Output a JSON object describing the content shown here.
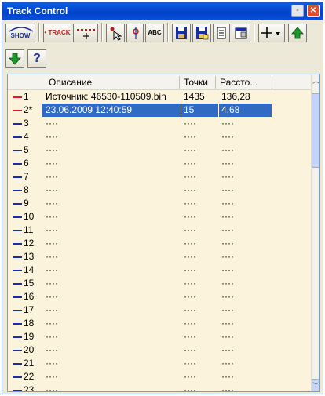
{
  "window": {
    "title": "Track Control"
  },
  "toolbar": {
    "show_label": "SHOW",
    "track_label": "• TRACK",
    "abc_label": "ABC"
  },
  "toolbar2": {
    "help_label": "?"
  },
  "list": {
    "columns": {
      "description": "Описание",
      "points": "Точки",
      "distance": "Рассто..."
    },
    "rows": [
      {
        "num": "1",
        "color": "#e0182a",
        "description": "Источник: 46530-110509.bin",
        "points": "1435",
        "distance": "136,28"
      },
      {
        "num": "2*",
        "color": "#e0182a",
        "description": "23.06.2009 12:40:59",
        "points": "15",
        "distance": "4,68",
        "selected": true
      },
      {
        "num": "3",
        "color": "#1a2ea0",
        "description": "····",
        "points": "····",
        "distance": "····"
      },
      {
        "num": "4",
        "color": "#1a2ea0",
        "description": "····",
        "points": "····",
        "distance": "····"
      },
      {
        "num": "5",
        "color": "#1a2ea0",
        "description": "····",
        "points": "····",
        "distance": "····"
      },
      {
        "num": "6",
        "color": "#1a2ea0",
        "description": "····",
        "points": "····",
        "distance": "····"
      },
      {
        "num": "7",
        "color": "#1a2ea0",
        "description": "····",
        "points": "····",
        "distance": "····"
      },
      {
        "num": "8",
        "color": "#1a2ea0",
        "description": "····",
        "points": "····",
        "distance": "····"
      },
      {
        "num": "9",
        "color": "#1a2ea0",
        "description": "····",
        "points": "····",
        "distance": "····"
      },
      {
        "num": "10",
        "color": "#1a2ea0",
        "description": "····",
        "points": "····",
        "distance": "····"
      },
      {
        "num": "11",
        "color": "#1a2ea0",
        "description": "····",
        "points": "····",
        "distance": "····"
      },
      {
        "num": "12",
        "color": "#1a2ea0",
        "description": "····",
        "points": "····",
        "distance": "····"
      },
      {
        "num": "13",
        "color": "#1a2ea0",
        "description": "····",
        "points": "····",
        "distance": "····"
      },
      {
        "num": "14",
        "color": "#1a2ea0",
        "description": "····",
        "points": "····",
        "distance": "····"
      },
      {
        "num": "15",
        "color": "#1a2ea0",
        "description": "····",
        "points": "····",
        "distance": "····"
      },
      {
        "num": "16",
        "color": "#1a2ea0",
        "description": "····",
        "points": "····",
        "distance": "····"
      },
      {
        "num": "17",
        "color": "#1a2ea0",
        "description": "····",
        "points": "····",
        "distance": "····"
      },
      {
        "num": "18",
        "color": "#1a2ea0",
        "description": "····",
        "points": "····",
        "distance": "····"
      },
      {
        "num": "19",
        "color": "#1a2ea0",
        "description": "····",
        "points": "····",
        "distance": "····"
      },
      {
        "num": "20",
        "color": "#1a2ea0",
        "description": "····",
        "points": "····",
        "distance": "····"
      },
      {
        "num": "21",
        "color": "#1a2ea0",
        "description": "····",
        "points": "····",
        "distance": "····"
      },
      {
        "num": "22",
        "color": "#1a2ea0",
        "description": "····",
        "points": "····",
        "distance": "····"
      },
      {
        "num": "23",
        "color": "#1a2ea0",
        "description": "····",
        "points": "····",
        "distance": "····"
      }
    ]
  },
  "colors": {
    "selection": "#316ac5",
    "list_bg": "#fbf3dc",
    "titlebar": "#0042c8"
  }
}
